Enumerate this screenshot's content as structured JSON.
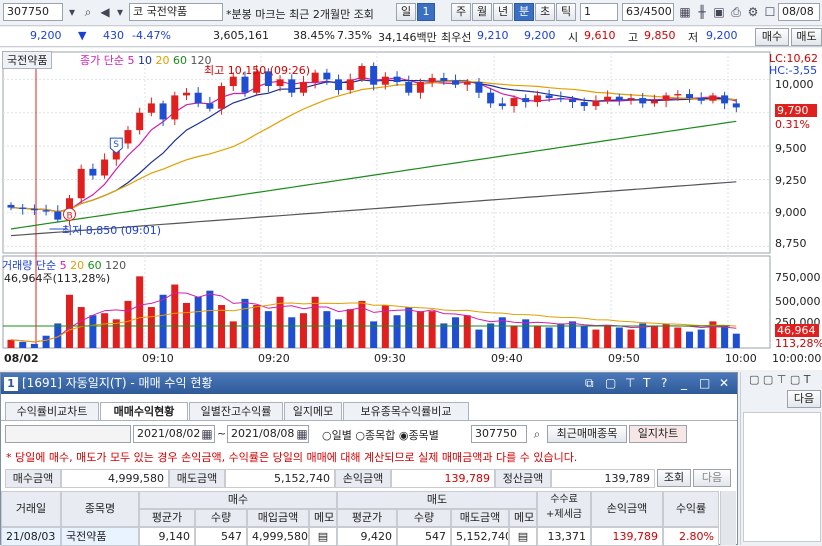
{
  "toolbar": {
    "code": "307750",
    "market": "코",
    "name": "국전약품",
    "notice": "*분봉 마크는 최근 2개월만 조회",
    "periods": [
      "일",
      "1",
      "주",
      "월",
      "년",
      "분",
      "초",
      "틱"
    ],
    "period_sel": "분",
    "tick_value": "1",
    "count": "63/4500",
    "date": "08/08"
  },
  "quote": {
    "price": "9,200",
    "arrow": "▼",
    "change": "430",
    "pct": "-4.47%",
    "volume": "3,605,161",
    "ratio1": "38.45%",
    "ratio2": "7.35%",
    "amount": "34,146백만",
    "best_label": "최우선",
    "best": "9,210",
    "ask": "9,200",
    "open_label": "시",
    "open": "9,610",
    "high_label": "고",
    "high": "9,850",
    "low_label": "저",
    "low": "9,200",
    "buy_btn": "매수",
    "sell_btn": "매도"
  },
  "chart": {
    "stock_label": "국전약품",
    "ma_label": "종가 단순",
    "ma_periods": [
      "5",
      "10",
      "20",
      "60",
      "120"
    ],
    "high_annot": "최고 10,150 (09:26)",
    "low_annot": "최저 8,850 (09:01)",
    "lc": "LC:10,62",
    "hc": "HC:-3,55",
    "price_tag": "9,790",
    "pct_tag": "0.31%",
    "price_ticks": [
      "10,000",
      "9,750",
      "9,500",
      "9,250",
      "9,000",
      "8,750"
    ],
    "vol_label": "거래량 단순",
    "vol_periods": [
      "5",
      "20",
      "60",
      "120"
    ],
    "vol_value": "46,964주(113,28%)",
    "vol_ticks": [
      "750,000",
      "500,000",
      "250,000"
    ],
    "vol_tag": "46,964",
    "vol_pct_tag": "113,28%",
    "date_label": "08/02",
    "time_ticks": [
      "09:10",
      "09:20",
      "09:30",
      "09:40",
      "09:50",
      "10:00"
    ],
    "time_right": "10:00:00",
    "colors": {
      "up": "#e0201f",
      "down": "#1f4fd0",
      "ma5": "#d01fb0",
      "ma10": "#1a2f9a",
      "ma20": "#e0a000",
      "ma60": "#1a8c1a",
      "ma120": "#555555"
    }
  },
  "chart_data": {
    "type": "bar",
    "series": [
      {
        "name": "거래량",
        "values": [
          40,
          30,
          20,
          60,
          120,
          260,
          200,
          160,
          170,
          140,
          230,
          350,
          200,
          260,
          310,
          220,
          250,
          280,
          210,
          130,
          240,
          210,
          180,
          250,
          150,
          170,
          250,
          180,
          140,
          190,
          230,
          130,
          210,
          160,
          200,
          180,
          180,
          120,
          150,
          160,
          90,
          120,
          150,
          110,
          140,
          110,
          100,
          120,
          130,
          110,
          90,
          110,
          100,
          90,
          120,
          110,
          120,
          100,
          80,
          90,
          130,
          110,
          70
        ]
      }
    ]
  },
  "panel": {
    "title": "[1691] 자동일지(T) - 매매 수익 현황",
    "num": "1",
    "tabs": [
      "수익률비교차트",
      "매매수익현황",
      "일별잔고수익률",
      "일지메모",
      "보유종목수익률비교"
    ],
    "date_from": "2021/08/02",
    "date_to": "2021/08/08",
    "radios": [
      "일별",
      "종목합",
      "종목별"
    ],
    "code": "307750",
    "recent_btn": "최근매매종목",
    "chart_btn": "일지차트",
    "notice": "* 당일에 매수, 매도가 모두 있는 경우 손익금액, 수익률은 당일의 매매에 대해 계산되므로 실제 매매금액과 다를 수 있습니다.",
    "sum": {
      "buy_label": "매수금액",
      "buy": "4,999,580",
      "sell_label": "매도금액",
      "sell": "5,152,740",
      "pl_label": "손익금액",
      "pl": "139,789",
      "settle_label": "정산금액",
      "settle": "139,789",
      "query_btn": "조회",
      "next_btn": "다음"
    },
    "headers": {
      "date": "거래일",
      "name": "종목명",
      "buy": "매수",
      "sell": "매도",
      "fee": "수수료+제세금",
      "pl": "손익금액",
      "rate": "수익률",
      "avg": "평균가",
      "qty": "수량",
      "buy_amt": "매입금액",
      "memo": "메모",
      "sell_amt": "매도금액"
    },
    "row": {
      "date": "21/08/03",
      "name": "국전약품",
      "buy_avg": "9,140",
      "buy_qty": "547",
      "buy_amt": "4,999,580",
      "sell_avg": "9,420",
      "sell_qty": "547",
      "sell_amt": "5,152,740",
      "fee": "13,371",
      "pl": "139,789",
      "rate": "2.80%"
    }
  },
  "right": {
    "next": "다음"
  }
}
